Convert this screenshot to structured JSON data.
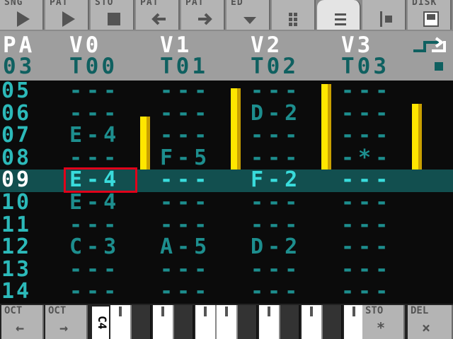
{
  "toolbar": {
    "buttons": [
      {
        "label": "SNG",
        "icon": "play-icon"
      },
      {
        "label": "PAT",
        "icon": "play-icon"
      },
      {
        "label": "STO",
        "icon": "stop-icon"
      },
      {
        "label": "PAT",
        "icon": "arrow-left-icon"
      },
      {
        "label": "PAT",
        "icon": "arrow-right-icon"
      },
      {
        "label": "ED",
        "icon": "dropdown-icon"
      },
      {
        "label": "",
        "icon": "grid-icon"
      },
      {
        "label": "",
        "icon": "list-icon"
      },
      {
        "label": "",
        "icon": "mixer-icon"
      },
      {
        "label": "DISK",
        "icon": "save-icon"
      }
    ]
  },
  "header": {
    "pattern_label": "PA",
    "pattern_number": "03",
    "voices": [
      {
        "name": "V0",
        "track": "T00"
      },
      {
        "name": "V1",
        "track": "T01"
      },
      {
        "name": "V2",
        "track": "T02"
      },
      {
        "name": "V3",
        "track": "T03"
      }
    ]
  },
  "rows": [
    {
      "num": "05",
      "cells": [
        "---",
        "---",
        "---",
        "---"
      ]
    },
    {
      "num": "06",
      "cells": [
        "---",
        "---",
        "D-2",
        "---"
      ]
    },
    {
      "num": "07",
      "cells": [
        "E-4",
        "---",
        "---",
        "---"
      ]
    },
    {
      "num": "08",
      "cells": [
        "---",
        "F-5",
        "---",
        "-*-"
      ]
    },
    {
      "num": "09",
      "cells": [
        "E-4",
        "---",
        "F-2",
        "---"
      ]
    },
    {
      "num": "10",
      "cells": [
        "E-4",
        "---",
        "---",
        "---"
      ]
    },
    {
      "num": "11",
      "cells": [
        "---",
        "---",
        "---",
        "---"
      ]
    },
    {
      "num": "12",
      "cells": [
        "C-3",
        "A-5",
        "D-2",
        "---"
      ]
    },
    {
      "num": "13",
      "cells": [
        "---",
        "---",
        "---",
        "---"
      ]
    },
    {
      "num": "14",
      "cells": [
        "---",
        "---",
        "---",
        "---"
      ]
    }
  ],
  "current_row": "09",
  "vu_levels": [
    0.6,
    0.92,
    0.97,
    0.74
  ],
  "keybar": {
    "oct_down": {
      "label": "OCT",
      "symbol": "←"
    },
    "oct_up": {
      "label": "OCT",
      "symbol": "→"
    },
    "octave": "C4",
    "sto": {
      "label": "STO",
      "symbol": "*"
    },
    "del": {
      "label": "DEL",
      "symbol": "×"
    }
  },
  "colors": {
    "accent": "#39dcdc",
    "cursor": "#e0001a",
    "vu": "#ffe600"
  }
}
